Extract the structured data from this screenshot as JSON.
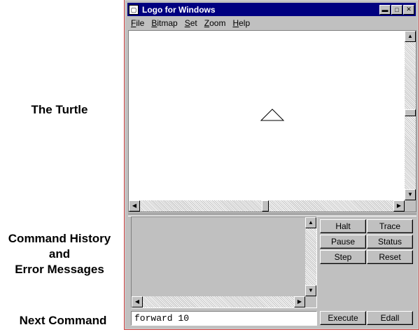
{
  "annotations": {
    "turtle": "The Turtle",
    "history": [
      "Command History",
      "and",
      "Error Messages"
    ],
    "next_command": "Next Command"
  },
  "window": {
    "title": "Logo for Windows",
    "menu": [
      {
        "acc": "F",
        "rest": "ile"
      },
      {
        "acc": "B",
        "rest": "itmap"
      },
      {
        "acc": "S",
        "rest": "et"
      },
      {
        "acc": "Z",
        "rest": "oom"
      },
      {
        "acc": "H",
        "rest": "elp"
      }
    ]
  },
  "buttons": {
    "halt": "Halt",
    "trace": "Trace",
    "pause": "Pause",
    "status": "Status",
    "step": "Step",
    "reset": "Reset",
    "execute": "Execute",
    "edall": "Edall"
  },
  "command": {
    "value": "forward 10"
  }
}
